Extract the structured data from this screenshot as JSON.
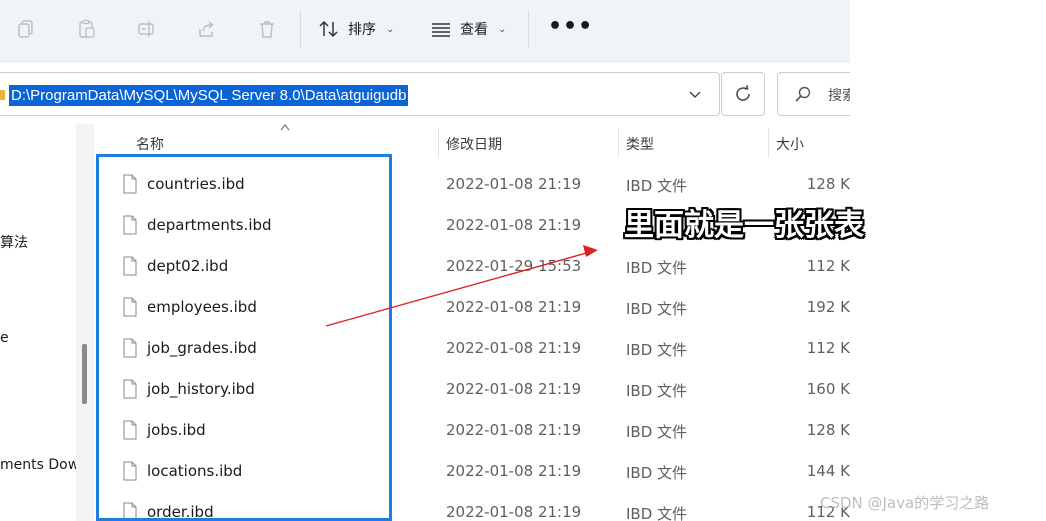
{
  "toolbar": {
    "sort_label": "排序",
    "view_label": "查看",
    "more_label": "•••"
  },
  "address": {
    "path": "D:\\ProgramData\\MySQL\\MySQL Server 8.0\\Data\\atguigudb",
    "search_placeholder": "搜索"
  },
  "nav": {
    "items": [
      "算法",
      "e",
      "ments Dow"
    ]
  },
  "columns": {
    "name": "名称",
    "date": "修改日期",
    "type": "类型",
    "size": "大小"
  },
  "files": [
    {
      "name": "countries.ibd",
      "date": "2022-01-08 21:19",
      "type": "IBD 文件",
      "size": "128 K"
    },
    {
      "name": "departments.ibd",
      "date": "2022-01-08 21:19",
      "type": "",
      "size": ""
    },
    {
      "name": "dept02.ibd",
      "date": "2022-01-29 15:53",
      "type": "IBD 文件",
      "size": "112 K"
    },
    {
      "name": "employees.ibd",
      "date": "2022-01-08 21:19",
      "type": "IBD 文件",
      "size": "192 K"
    },
    {
      "name": "job_grades.ibd",
      "date": "2022-01-08 21:19",
      "type": "IBD 文件",
      "size": "112 K"
    },
    {
      "name": "job_history.ibd",
      "date": "2022-01-08 21:19",
      "type": "IBD 文件",
      "size": "160 K"
    },
    {
      "name": "jobs.ibd",
      "date": "2022-01-08 21:19",
      "type": "IBD 文件",
      "size": "128 K"
    },
    {
      "name": "locations.ibd",
      "date": "2022-01-08 21:19",
      "type": "IBD 文件",
      "size": "144 K"
    },
    {
      "name": "order.ibd",
      "date": "2022-01-08 21:19",
      "type": "IBD 文件",
      "size": "112 K"
    }
  ],
  "annotation": {
    "text": "里面就是一张张表",
    "highlight_color": "#1e7fe0",
    "arrow_color": "#e02020"
  },
  "watermark": "CSDN @Java的学习之路",
  "colors": {
    "selection": "#0a64d6",
    "toolbar_bg": "#eff4f8"
  }
}
